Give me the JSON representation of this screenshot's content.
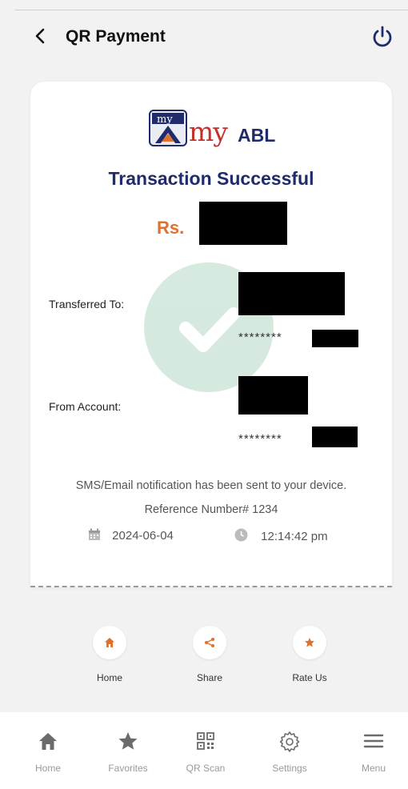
{
  "header": {
    "title": "QR Payment"
  },
  "receipt": {
    "logo_text": "my",
    "logo_abl": "ABL",
    "status": "Transaction Successful",
    "amount_prefix": "Rs.",
    "transferred_to_label": "Transferred To:",
    "transferred_to_account": "********",
    "from_account_label": "From Account:",
    "from_account_number": "********",
    "notification": "SMS/Email notification has been sent to your device.",
    "reference": "Reference Number# 1234",
    "date": "2024-06-04",
    "time": "12:14:42 pm"
  },
  "quick_actions": [
    {
      "label": "Home",
      "icon": "home-icon"
    },
    {
      "label": "Share",
      "icon": "share-icon"
    },
    {
      "label": "Rate Us",
      "icon": "star-icon"
    }
  ],
  "bottom_nav": [
    {
      "label": "Home",
      "icon": "home-icon"
    },
    {
      "label": "Favorites",
      "icon": "star-icon"
    },
    {
      "label": "QR Scan",
      "icon": "qr-icon"
    },
    {
      "label": "Settings",
      "icon": "gear-icon"
    },
    {
      "label": "Menu",
      "icon": "menu-icon"
    }
  ],
  "colors": {
    "accent_orange": "#e0702c",
    "brand_navy": "#1f2b6b",
    "brand_red": "#c4312b",
    "success_green": "#cfe6d9"
  }
}
